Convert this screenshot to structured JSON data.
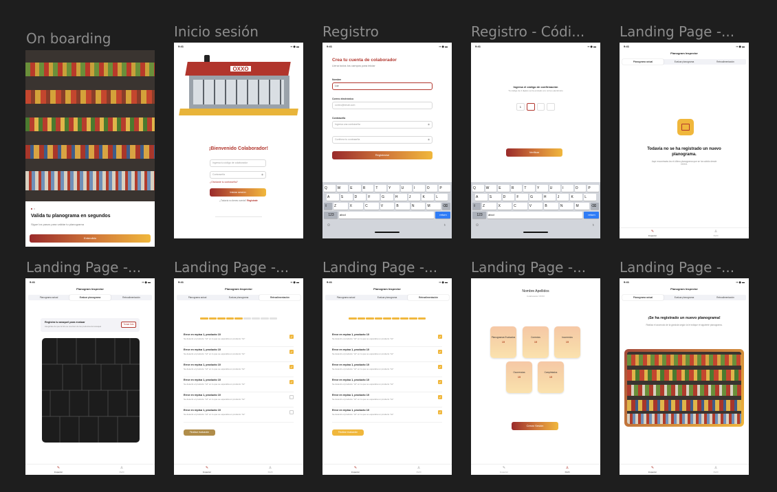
{
  "frames": {
    "onboarding": {
      "title": "On boarding",
      "heading": "Valida tu planograma en segundos",
      "subtext": "Sigue los pasos para validar tu planograma",
      "button": "Entendido"
    },
    "login": {
      "title": "Inicio sesión",
      "status_time": "9:41",
      "welcome": "¡Bienvenido Colaborador!",
      "user_placeholder": "Ingresa tu código de colaborador",
      "password_placeholder": "Contraseña",
      "forgot": "¿Olvidaste tu contraseña?",
      "button": "Iniciar sesión",
      "register_prompt": "¿Todavía no tienes cuenta?",
      "register_link": "Registrate"
    },
    "register": {
      "title": "Registro",
      "status_time": "9:41",
      "heading": "Crea tu cuenta de colaborador",
      "subtext": "Llena todos los campos para iniciar",
      "name_label": "Nombre",
      "name_value": "Luz",
      "email_label": "Correo electrónico",
      "email_placeholder": "correo@email.com",
      "password_label": "Contraseña",
      "password_placeholder": "Ingresa una contraseña",
      "confirm_placeholder": "Confirma tu contraseña",
      "button": "Registrarse",
      "kb_field": "abcd"
    },
    "register_code": {
      "title": "Registro - Códi...",
      "status_time": "9:41",
      "heading": "Ingresa el código de confirmación",
      "subtext": "Tu código de 4 dígitos se ha enviado a tu correo electrónico",
      "digits": [
        "1",
        "",
        "",
        ""
      ],
      "button": "Verificar",
      "kb_field": "abcd"
    },
    "landing_empty": {
      "title": "Landing Page -...",
      "status_time": "9:41",
      "page_title": "Planogram Inspector",
      "tabs": [
        "Planograma actual",
        "Evaluar planograma",
        "Retroalimentación"
      ],
      "heading": "Todavía no se ha registrado un nuevo planograma.",
      "subtext": "Aquí encontrarás los el último planograma que se ha subido desde OXXO."
    },
    "landing_evaluate": {
      "title": "Landing Page -...",
      "status_time": "9:41",
      "page_title": "Planogram Inspector",
      "tabs": [
        "Planograma actual",
        "Evaluar planograma",
        "Retroalimentación"
      ],
      "notice_title": "Registra tu anaquel para evaluar",
      "notice_text": "Asegúrate de que la foto se vea bien de los productos del anaquel",
      "notice_button": "Tomar foto"
    },
    "landing_feedback_a": {
      "title": "Landing Page -...",
      "status_time": "9:41",
      "page_title": "Planogram Inspector",
      "tabs": [
        "Planograma actual",
        "Evaluar planograma",
        "Retroalimentación"
      ],
      "progress": [
        1,
        1,
        1,
        1,
        1,
        0,
        0,
        0,
        0
      ],
      "errors": [
        {
          "title": "Error en repisa 1, producto 10",
          "desc": "Se detectó el producto \"xd\" en lo que se esperaba un producto \"lol\"",
          "checked": true
        },
        {
          "title": "Error en repisa 1, producto 10",
          "desc": "Se detectó el producto \"xd\" en lo que se esperaba un producto \"lol\"",
          "checked": true
        },
        {
          "title": "Error en repisa 1, producto 10",
          "desc": "Se detectó el producto \"xd\" en lo que se esperaba un producto \"lol\"",
          "checked": true
        },
        {
          "title": "Error en repisa 1, producto 10",
          "desc": "Se detectó el producto \"xd\" en lo que se esperaba un producto \"lol\"",
          "checked": true
        },
        {
          "title": "Error en repisa 1, producto 10",
          "desc": "Se detectó el producto \"xd\" en lo que se esperaba un producto \"lol\"",
          "checked": false
        },
        {
          "title": "Error en repisa 1, producto 10",
          "desc": "Se detectó el producto \"xd\" en lo que se esperaba un producto \"lol\"",
          "checked": false
        }
      ],
      "button": "Finalizar evaluación"
    },
    "landing_feedback_b": {
      "title": "Landing Page -...",
      "status_time": "9:41",
      "page_title": "Planogram Inspector",
      "tabs": [
        "Planograma actual",
        "Evaluar planograma",
        "Retroalimentación"
      ],
      "progress": [
        1,
        1,
        1,
        1,
        1,
        1,
        1,
        1,
        1
      ],
      "errors": [
        {
          "title": "Error en repisa 1, producto 10",
          "desc": "Se detectó el producto \"xd\" en lo que se esperaba un producto \"lol\"",
          "checked": true
        },
        {
          "title": "Error en repisa 1, producto 10",
          "desc": "Se detectó el producto \"xd\" en lo que se esperaba un producto \"lol\"",
          "checked": true
        },
        {
          "title": "Error en repisa 1, producto 10",
          "desc": "Se detectó el producto \"xd\" en lo que se esperaba un producto \"lol\"",
          "checked": true
        },
        {
          "title": "Error en repisa 1, producto 10",
          "desc": "Se detectó el producto \"xd\" en lo que se esperaba un producto \"lol\"",
          "checked": true
        },
        {
          "title": "Error en repisa 1, producto 10",
          "desc": "Se detectó el producto \"xd\" en lo que se esperaba un producto \"lol\"",
          "checked": true
        },
        {
          "title": "Error en repisa 1, producto 10",
          "desc": "Se detectó el producto \"xd\" en lo que se esperaba un producto \"lol\"",
          "checked": true
        }
      ],
      "button": "Finalizar evaluación"
    },
    "profile": {
      "title": "Landing Page -...",
      "name": "Nombre Apellidos",
      "subtext": "Colaborador OXXO",
      "stats": [
        {
          "label": "Planogramas Evaluados",
          "value": "15"
        },
        {
          "label": "Correctos",
          "value": "15"
        },
        {
          "label": "Incorrectos",
          "value": "15"
        },
        {
          "label": "Ocurrencias",
          "value": "15"
        },
        {
          "label": "Completados",
          "value": "15"
        }
      ],
      "button": "Cerrar Sesión"
    },
    "landing_new": {
      "title": "Landing Page -...",
      "status_time": "9:41",
      "page_title": "Planogram Inspector",
      "tabs": [
        "Planograma actual",
        "Evaluar planograma",
        "Retroalimentación"
      ],
      "heading": "¡Se ha registrado un nuevo planograma!",
      "subtext": "Realiza el acomodo de la góndola según la le indique el siguiente planograma."
    }
  },
  "nav": {
    "left": "Inspector",
    "right": "Perfil"
  },
  "keyboard": {
    "row1": [
      "Q",
      "W",
      "E",
      "R",
      "T",
      "Y",
      "U",
      "I",
      "O",
      "P"
    ],
    "row2": [
      "A",
      "S",
      "D",
      "F",
      "G",
      "H",
      "J",
      "K",
      "L"
    ],
    "row3": [
      "Z",
      "X",
      "C",
      "V",
      "B",
      "N",
      "M"
    ],
    "return": "return"
  },
  "colors": {
    "brand_red": "#9a2b2b",
    "brand_yellow": "#f0b73c",
    "canvas": "#1e1e1e"
  }
}
